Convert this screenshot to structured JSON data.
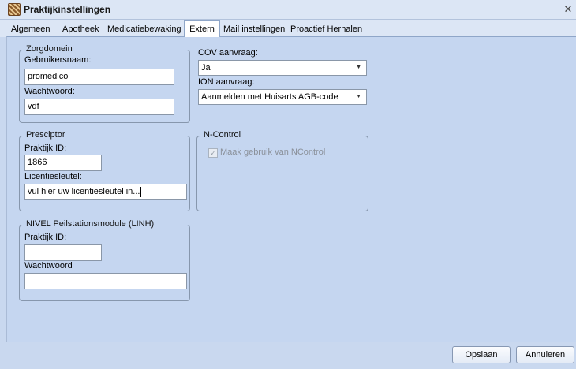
{
  "window": {
    "title": "Praktijkinstellingen"
  },
  "tabs": [
    {
      "label": "Algemeen",
      "active": false
    },
    {
      "label": "Apotheek",
      "active": false
    },
    {
      "label": "Medicatiebewaking",
      "active": false
    },
    {
      "label": "Extern",
      "active": true
    },
    {
      "label": "Mail instellingen",
      "active": false
    },
    {
      "label": "Proactief Herhalen",
      "active": false
    }
  ],
  "zorgdomein": {
    "legend": "Zorgdomein",
    "username_label": "Gebruikersnaam:",
    "username_value": "promedico",
    "password_label": "Wachtwoord:",
    "password_value": "vdf"
  },
  "cov": {
    "label": "COV aanvraag:",
    "selected": "Ja"
  },
  "ion": {
    "label": "ION aanvraag:",
    "selected": "Aanmelden met Huisarts AGB-code"
  },
  "presciptor": {
    "legend": "Presciptor",
    "practice_id_label": "Praktijk ID:",
    "practice_id_value": "1866",
    "license_label": "Licentiesleutel:",
    "license_value": "vul hier uw licentiesleutel in..."
  },
  "ncontrol": {
    "legend": "N-Control",
    "checkbox_label": "Maak gebruik van NControl",
    "checked": true,
    "enabled": false
  },
  "nivel": {
    "legend": "NIVEL Peilstationsmodule (LINH)",
    "practice_id_label": "Praktijk ID:",
    "practice_id_value": "",
    "password_label": "Wachtwoord",
    "password_value": ""
  },
  "footer": {
    "save_label": "Opslaan",
    "cancel_label": "Annuleren"
  }
}
